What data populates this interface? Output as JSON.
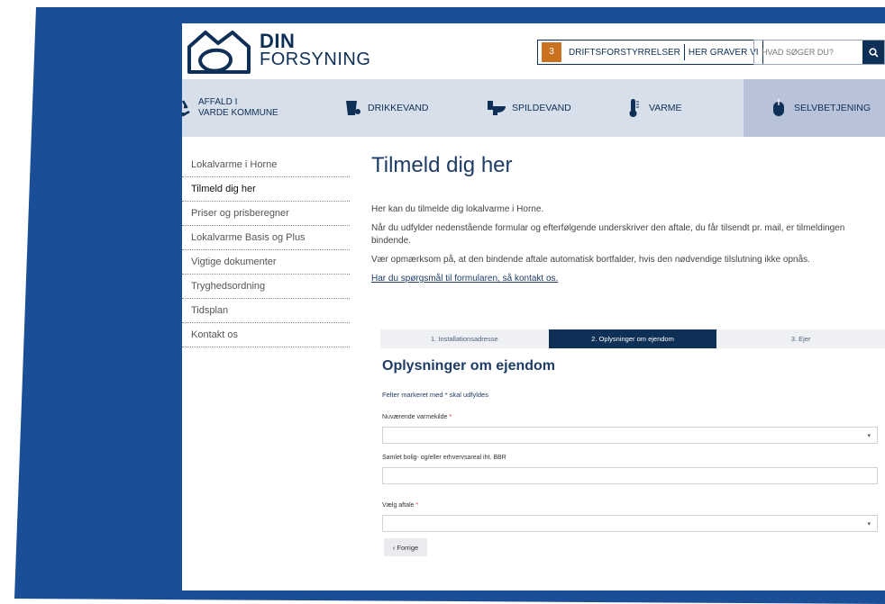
{
  "header": {
    "logo": {
      "line1": "DIN",
      "line2": "FORSYNING"
    },
    "alerts": {
      "count": "3",
      "disruptions": "DRIFTSFORSTYRRELSER",
      "digging": "HER GRAVER VI"
    },
    "search": {
      "placeholder": "HVAD SØGER DU?"
    }
  },
  "nav": {
    "affald_line1": "AFFALD I",
    "affald_line2": "VARDE KOMMUNE",
    "drikkevand": "DRIKKEVAND",
    "spildevand": "SPILDEVAND",
    "varme": "VARME",
    "selvbetjening": "SELVBETJENING"
  },
  "sidebar": {
    "items": [
      {
        "label": "Lokalvarme i Horne"
      },
      {
        "label": "Tilmeld dig her"
      },
      {
        "label": "Priser og prisberegner"
      },
      {
        "label": "Lokalvarme Basis og Plus"
      },
      {
        "label": "Vigtige dokumenter"
      },
      {
        "label": "Tryghedsordning"
      },
      {
        "label": "Tidsplan"
      },
      {
        "label": "Kontakt os"
      }
    ]
  },
  "content": {
    "title": "Tilmeld dig her",
    "p1": "Her kan du tilmelde dig lokalvarme i Horne.",
    "p2": "Når du udfylder nedenstående formular og efterfølgende underskriver den aftale, du får tilsendt pr. mail, er tilmeldingen bindende.",
    "p3": "Vær opmærksom på, at den bindende aftale automatisk bortfalder, hvis den nødvendige tilslutning ikke opnås.",
    "contact_link": "Har du spørgsmål til formularen, så kontakt os."
  },
  "steps": [
    {
      "label": "1.  Installationsadresse"
    },
    {
      "label": "2.  Oplysninger om ejendom"
    },
    {
      "label": "3.  Ejer"
    }
  ],
  "form": {
    "title": "Oplysninger om ejendom",
    "required_note": "Felter markeret med * skal udfyldes",
    "field1_label": "Nuværende varmekilde",
    "field2_label": "Samlet bolig- og/eller erhvervsareal iht. BBR",
    "field3_label": "Vælg aftale",
    "required_star": "*",
    "prev_button": "‹  Forrige"
  },
  "colors": {
    "brand": "#0e2f56",
    "nav_bg": "#d7dfeb",
    "nav_active": "#b8c3da",
    "badge": "#c9731e"
  }
}
